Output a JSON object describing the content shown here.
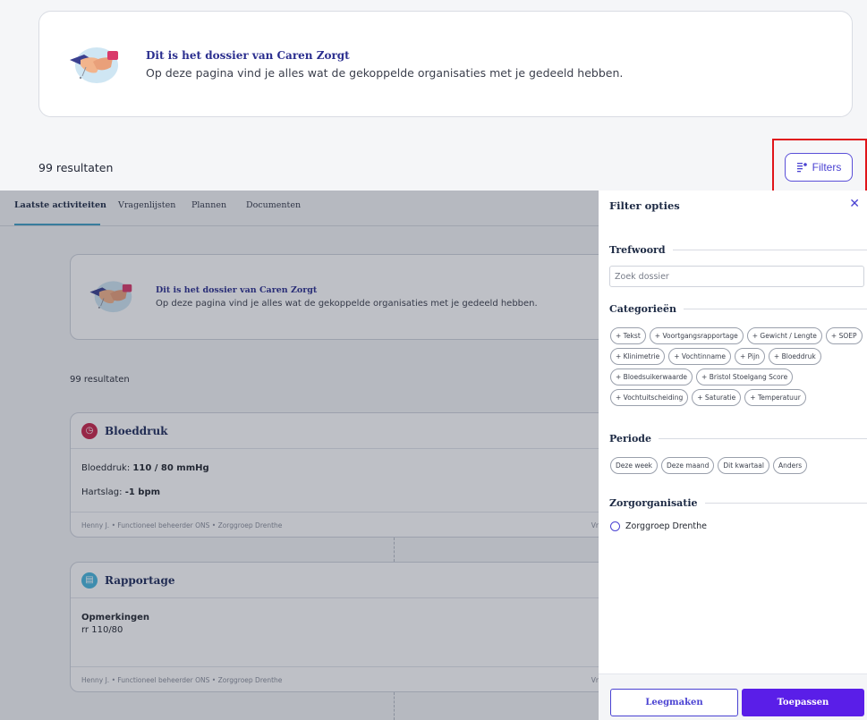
{
  "header": {
    "card_title": "Dit is het dossier van Caren Zorgt",
    "card_subtitle": "Op deze pagina vind je alles wat de gekoppelde organisaties met je gedeeld hebben.",
    "results": "99 resultaten",
    "filters_label": "Filters",
    "filters_icon": "filter-lines-icon",
    "highlight_color": "#e0151a"
  },
  "tabs": [
    {
      "label": "Laatste activiteiten",
      "active": true
    },
    {
      "label": "Vragenlijsten"
    },
    {
      "label": "Plannen"
    },
    {
      "label": "Documenten"
    }
  ],
  "inner": {
    "card_title": "Dit is het dossier van Caren Zorgt",
    "card_subtitle": "Op deze pagina vind je alles wat de gekoppelde organisaties met je gedeeld hebben.",
    "results": "99 resultaten"
  },
  "activities": [
    {
      "title": "Bloeddruk",
      "icon": "blood-pressure-icon",
      "color": "#c8254a",
      "line1_label": "Bloeddruk:",
      "line1_value": "110 / 80 mmHg",
      "line2_label": "Hartslag:",
      "line2_value": "-1 bpm",
      "footer": "Henny J. • Functioneel beheerder ONS • Zorggroep Drenthe",
      "footer_right": "Vr"
    },
    {
      "title": "Rapportage",
      "icon": "report-icon",
      "color": "#48b6dd",
      "line1_label": "Opmerkingen",
      "line2_value": "rr 110/80",
      "footer": "Henny J. • Functioneel beheerder ONS • Zorggroep Drenthe",
      "footer_right": "Vr"
    }
  ],
  "panel": {
    "title": "Filter opties",
    "close_icon": "close-icon",
    "trefwoord_label": "Trefwoord",
    "search_placeholder": "Zoek dossier",
    "categories_label": "Categorieën",
    "categories": [
      "+ Tekst",
      "+ Voortgangsrapportage",
      "+ Gewicht / Lengte",
      "+ SOEP",
      "+ Klinimetrie",
      "+ Vochtinname",
      "+ Pijn",
      "+ Bloeddruk",
      "+ Bloedsuikerwaarde",
      "+ Bristol Stoelgang Score",
      "+ Vochtuitscheiding",
      "+ Saturatie",
      "+ Temperatuur"
    ],
    "periode_label": "Periode",
    "periods": [
      "Deze week",
      "Deze maand",
      "Dit kwartaal",
      "Anders"
    ],
    "org_label": "Zorgorganisatie",
    "org_option": "Zorggroep Drenthe",
    "clear_label": "Leegmaken",
    "apply_label": "Toepassen",
    "apply_color": "#5a1ee8"
  }
}
